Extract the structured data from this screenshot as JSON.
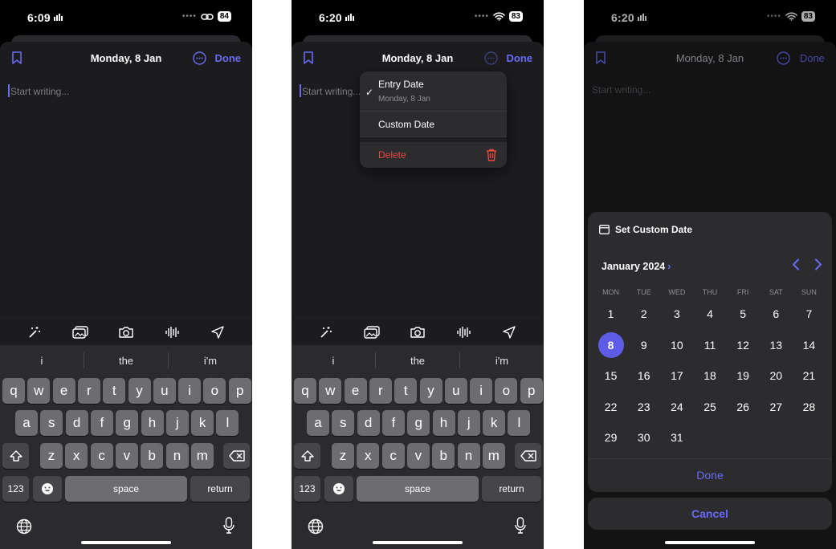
{
  "accent": "#6a6af5",
  "screens": [
    {
      "time": "6:09",
      "battery": "84",
      "nav": {
        "title": "Monday, 8 Jan",
        "done": "Done"
      },
      "editor_placeholder": "Start writing...",
      "suggestions": [
        "i",
        "the",
        "i'm"
      ]
    },
    {
      "time": "6:20",
      "battery": "83",
      "nav": {
        "title": "Monday, 8 Jan",
        "done": "Done"
      },
      "editor_placeholder": "Start writing...",
      "suggestions": [
        "i",
        "the",
        "i'm"
      ],
      "menu": {
        "entry_date": "Entry Date",
        "entry_date_value": "Monday, 8 Jan",
        "custom_date": "Custom Date",
        "delete": "Delete"
      }
    },
    {
      "time": "6:20",
      "battery": "83",
      "nav": {
        "title": "Monday, 8 Jan",
        "done": "Done"
      },
      "editor_placeholder": "Start writing...",
      "calendar": {
        "header": "Set Custom Date",
        "month": "January 2024",
        "weekdays": [
          "MON",
          "TUE",
          "WED",
          "THU",
          "FRI",
          "SAT",
          "SUN"
        ],
        "weeks": [
          [
            "1",
            "2",
            "3",
            "4",
            "5",
            "6",
            "7"
          ],
          [
            "8",
            "9",
            "10",
            "11",
            "12",
            "13",
            "14"
          ],
          [
            "15",
            "16",
            "17",
            "18",
            "19",
            "20",
            "21"
          ],
          [
            "22",
            "23",
            "24",
            "25",
            "26",
            "27",
            "28"
          ],
          [
            "29",
            "30",
            "31",
            "",
            "",
            "",
            ""
          ]
        ],
        "selected": "8",
        "done": "Done",
        "cancel": "Cancel"
      }
    }
  ],
  "keyboard": {
    "row1": [
      "q",
      "w",
      "e",
      "r",
      "t",
      "y",
      "u",
      "i",
      "o",
      "p"
    ],
    "row2": [
      "a",
      "s",
      "d",
      "f",
      "g",
      "h",
      "j",
      "k",
      "l"
    ],
    "row3": [
      "z",
      "x",
      "c",
      "v",
      "b",
      "n",
      "m"
    ],
    "numbers": "123",
    "space": "space",
    "return": "return"
  }
}
